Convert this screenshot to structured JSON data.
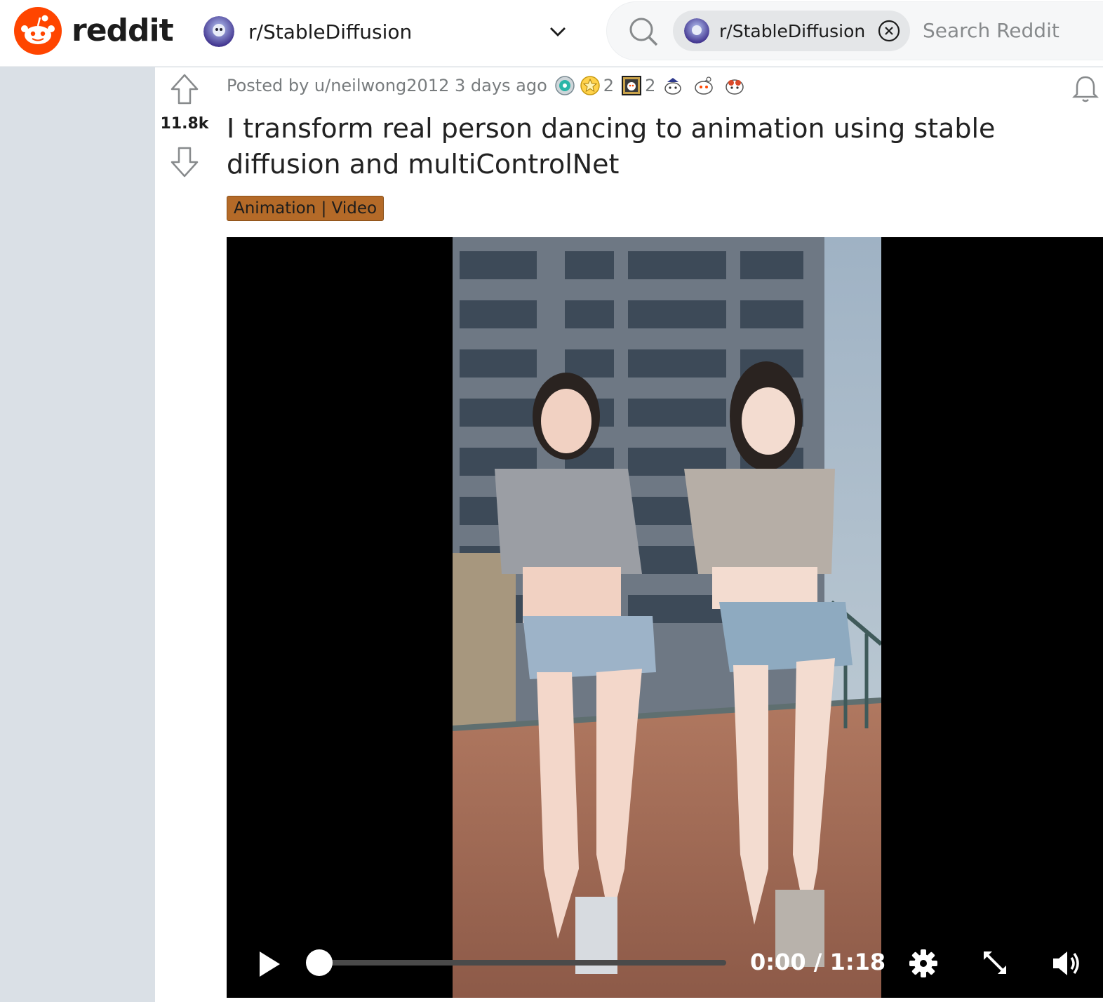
{
  "header": {
    "logo_text": "reddit",
    "community_name": "r/StableDiffusion",
    "search": {
      "chip_label": "r/StableDiffusion",
      "placeholder": "Search Reddit"
    }
  },
  "post": {
    "vote_count": "11.8k",
    "posted_by": "Posted by u/neilwong2012 3 days ago",
    "awards": [
      {
        "icon": "helpful-award-icon",
        "count": ""
      },
      {
        "icon": "star-award-icon",
        "count": "2"
      },
      {
        "icon": "framed-award-icon",
        "count": "2"
      },
      {
        "icon": "snoo-award-icon-1",
        "count": ""
      },
      {
        "icon": "snoo-award-icon-2",
        "count": ""
      },
      {
        "icon": "snoo-award-icon-3",
        "count": ""
      }
    ],
    "title": "I transform real person dancing to animation using stable diffusion and multiControlNet",
    "flair": "Animation | Video",
    "video": {
      "time": "0:00 / 1:18",
      "progress": 0.0
    }
  },
  "colors": {
    "brand": "#ff4500",
    "flair_bg": "#b46a28",
    "page_bg": "#dae0e6"
  }
}
